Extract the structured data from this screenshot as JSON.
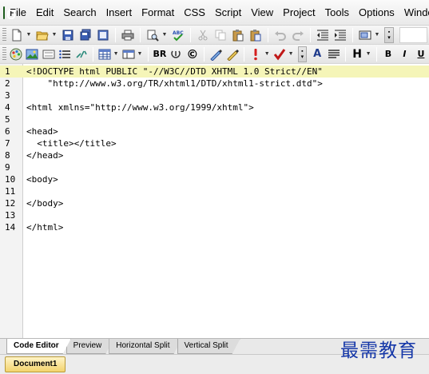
{
  "menu": {
    "items": [
      "File",
      "Edit",
      "Search",
      "Insert",
      "Format",
      "CSS",
      "Script",
      "View",
      "Project",
      "Tools",
      "Options",
      "Windo"
    ]
  },
  "toolbar1": {
    "icons": [
      "new-document-icon",
      "open-folder-icon",
      "save-icon",
      "save-all-icon",
      "close-doc-icon",
      "print-icon",
      "preview-icon",
      "spell-check-icon",
      "cut-icon",
      "copy-icon",
      "paste-icon",
      "paste-special-icon",
      "undo-icon",
      "redo-icon",
      "outdent-icon",
      "indent-icon",
      "block-icon"
    ]
  },
  "toolbar2": {
    "br_label": "BR",
    "copyright_label": "©",
    "heading_label": "H",
    "bold_label": "B",
    "italic_label": "I",
    "underline_label": "U",
    "font_label": "A"
  },
  "editor": {
    "current_line": 1,
    "lines": [
      {
        "n": "1",
        "text": "<!DOCTYPE html PUBLIC \"-//W3C//DTD XHTML 1.0 Strict//EN\""
      },
      {
        "n": "2",
        "text": "    \"http://www.w3.org/TR/xhtml1/DTD/xhtml1-strict.dtd\">"
      },
      {
        "n": "3",
        "text": ""
      },
      {
        "n": "4",
        "text": "<html xmlns=\"http://www.w3.org/1999/xhtml\">"
      },
      {
        "n": "5",
        "text": ""
      },
      {
        "n": "6",
        "text": "<head>"
      },
      {
        "n": "7",
        "text": "  <title></title>"
      },
      {
        "n": "8",
        "text": "</head>"
      },
      {
        "n": "9",
        "text": ""
      },
      {
        "n": "10",
        "text": "<body>"
      },
      {
        "n": "11",
        "text": ""
      },
      {
        "n": "12",
        "text": "</body>"
      },
      {
        "n": "13",
        "text": ""
      },
      {
        "n": "14",
        "text": "</html>"
      }
    ]
  },
  "view_tabs": [
    "Code Editor",
    "Preview",
    "Horizontal Split",
    "Vertical Split"
  ],
  "active_view_tab": "Code Editor",
  "document_tab": "Document1",
  "watermark": "最需教育"
}
